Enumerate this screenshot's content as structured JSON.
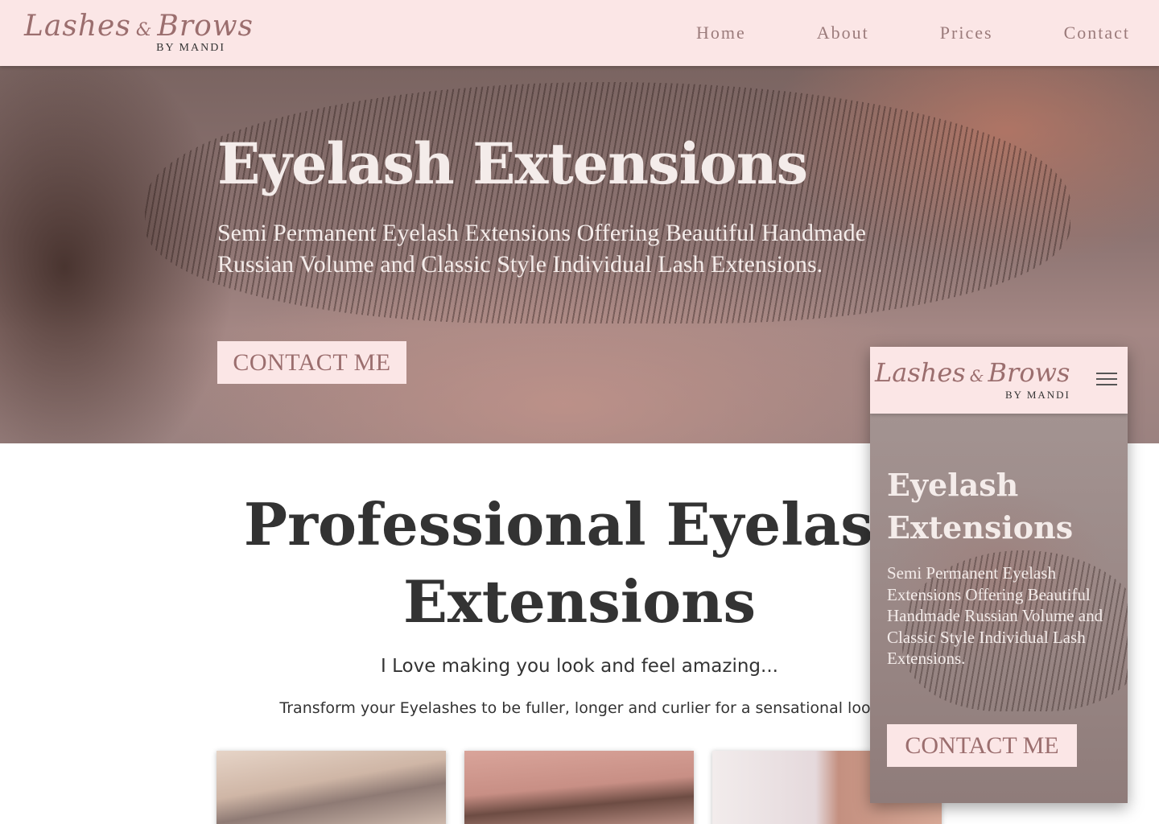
{
  "header": {
    "logo_script_left": "Lashes",
    "logo_amp": "&",
    "logo_script_right": "Brows",
    "logo_sub": "BY MANDI",
    "nav": [
      "Home",
      "About",
      "Prices",
      "Contact"
    ]
  },
  "hero": {
    "title": "Eyelash Extensions",
    "subtitle": "Semi Permanent Eyelash Extensions Offering Beautiful Handmade Russian Volume and Classic Style Individual Lash Extensions.",
    "cta": "CONTACT ME"
  },
  "section": {
    "title": "Professional Eyelash Extensions",
    "lead": "I Love making you look and feel amazing...",
    "desc": "Transform your Eyelashes to be fuller, longer and curlier for a sensational look"
  },
  "mobile": {
    "logo_script_left": "Lashes",
    "logo_amp": "&",
    "logo_script_right": "Brows",
    "logo_sub": "BY MANDI",
    "hero_title": "Eyelash Extensions",
    "hero_subtitle": "Semi Permanent Eyelash Extensions Offering Beautiful Handmade Russian Volume and Classic Style Individual Lash Extensions.",
    "cta": "CONTACT ME"
  },
  "colors": {
    "header_bg": "#fbe6e6",
    "brand": "#9b6e6e",
    "text_dark": "#333333"
  },
  "icons": {
    "menu": "hamburger-icon"
  }
}
